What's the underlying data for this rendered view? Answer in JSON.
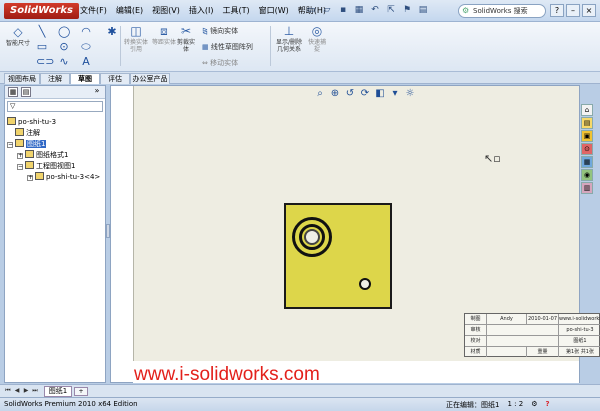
{
  "app": {
    "logo_text": "SolidWorks",
    "status_text": "SolidWorks Premium 2010 x64 Edition"
  },
  "menu": [
    "文件(F)",
    "编辑(E)",
    "视图(V)",
    "插入(I)",
    "工具(T)",
    "窗口(W)",
    "帮助(H)"
  ],
  "search": {
    "placeholder": "SolidWorks 搜索"
  },
  "ribbon": {
    "smart_dim_label": "智能尺寸",
    "mirror_label": "镜向实体",
    "linear_pattern_label": "线性草图阵列",
    "display_delete_label": "显示/删除几何关系",
    "quick_snap_label": "快速捕捉",
    "convert_label": "转换实体引用",
    "offset_label": "等距实体",
    "trim_label": "剪裁实体",
    "move_label": "移动实体"
  },
  "tabs": [
    "视图布局",
    "注解",
    "草图",
    "评估",
    "办公室产品"
  ],
  "active_tab": "草图",
  "tree": {
    "filter_placeholder": "",
    "root": "po-shi-tu-3",
    "annotations": "注解",
    "sheet": "图纸1",
    "sheet_format": "图纸格式1",
    "drawing_view": "工程图视图1",
    "model": "po-shi-tu-3<4>"
  },
  "title_block": {
    "drawn_label": "制图",
    "drawn_by": "Andy",
    "date": "2010-01-07",
    "site": "www.i-solidworks.com",
    "review_label": "审核",
    "part_name": "po-shi-tu-3",
    "check_label": "校对",
    "drawing_no": "图纸1",
    "material_label": "材质",
    "weight_label": "重量",
    "sheet_count": "第1张 共1张"
  },
  "sheet_tab": "图纸1",
  "statusbar": {
    "editing": "正在编辑：图纸1",
    "scale": "1 : 2",
    "help": "?"
  },
  "watermark": "www.i-solidworks.com"
}
